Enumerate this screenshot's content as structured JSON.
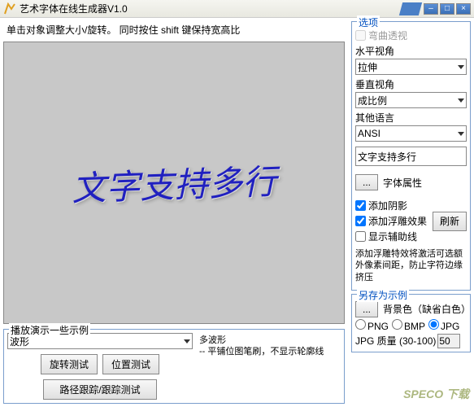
{
  "window": {
    "title": "艺术字体在线生成器V1.0"
  },
  "hint": "单击对象调整大小/旋转。 同时按住 shift 键保持宽高比",
  "canvas_text": "文字支持多行",
  "demo": {
    "legend": "播放演示一些示例",
    "selected": "波形",
    "desc": "多波形\n-- 平铺位图笔刷，不显示轮廓线",
    "btn_rotate": "旋转测试",
    "btn_position": "位置测试",
    "btn_path": "路径跟踪/跟踪测试"
  },
  "options": {
    "legend": "选项",
    "bend": "弯曲透视",
    "hview_lbl": "水平视角",
    "hview_val": "拉伸",
    "vview_lbl": "垂直视角",
    "vview_val": "成比例",
    "lang_lbl": "其他语言",
    "lang_val": "ANSI",
    "text_val": "文字支持多行",
    "font_btn": "字体属性",
    "ellipsis": "...",
    "shadow": "添加阴影",
    "emboss": "添加浮雕效果",
    "aux": "显示辅助线",
    "refresh": "刷新",
    "note": "添加浮雕特效将激活可选额外像素间距，防止字符边缘挤压"
  },
  "save": {
    "legend": "另存为示例",
    "bgcolor": "背景色（缺省白色）",
    "ellipsis": "...",
    "png": "PNG",
    "bmp": "BMP",
    "jpg": "JPG",
    "quality_lbl": "JPG 质量 (30-100)",
    "quality_val": "50"
  },
  "watermark": "SPECO 下载"
}
